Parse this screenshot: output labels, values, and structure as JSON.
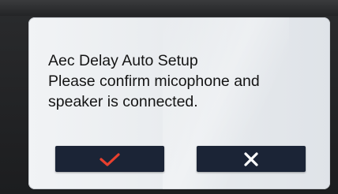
{
  "dialog": {
    "lines": [
      "Aec Delay Auto Setup",
      "Please confirm micophone and",
      "speaker is connected."
    ]
  },
  "buttons": {
    "confirm": {
      "icon": "check-icon",
      "color": "#e8402e"
    },
    "cancel": {
      "icon": "close-icon",
      "color": "#ffffff"
    }
  },
  "colors": {
    "dialog_bg": "#eceff2",
    "button_bg": "#1b2436"
  }
}
